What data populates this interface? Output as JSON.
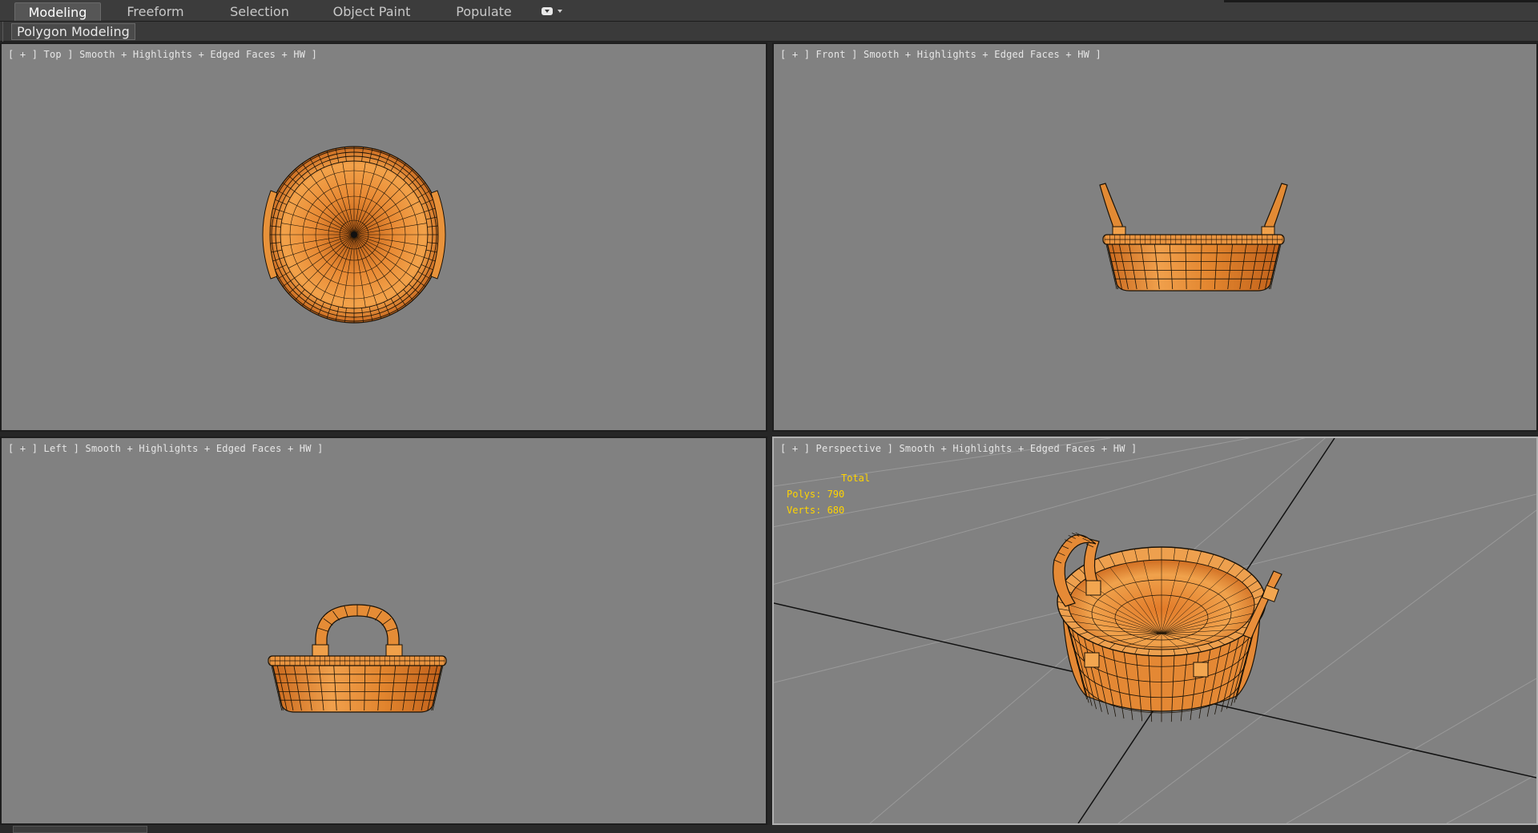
{
  "ribbon": {
    "tabs": [
      {
        "label": "Modeling",
        "active": true
      },
      {
        "label": "Freeform",
        "active": false
      },
      {
        "label": "Selection",
        "active": false
      },
      {
        "label": "Object Paint",
        "active": false
      },
      {
        "label": "Populate",
        "active": false
      }
    ],
    "panel_label": "Polygon Modeling"
  },
  "viewports": {
    "top": {
      "label": "[ + ] Top ] Smooth + Highlights + Edged Faces + HW ]"
    },
    "front": {
      "label": "[ + ] Front ] Smooth + Highlights + Edged Faces + HW ]"
    },
    "left": {
      "label": "[ + ] Left ] Smooth + Highlights + Edged Faces + HW ]"
    },
    "perspective": {
      "label": "[ + ] Perspective ] Smooth + Highlights + Edged Faces + HW ]"
    }
  },
  "stats": {
    "total_label": "Total",
    "polys": "Polys: 790",
    "verts": "Verts: 680"
  },
  "colors": {
    "viewport_bg": "#818181",
    "basket_fill": "#e0802e",
    "basket_highlight": "#f5b05a",
    "wire": "#1a1207",
    "stats_text": "#ffd400"
  }
}
